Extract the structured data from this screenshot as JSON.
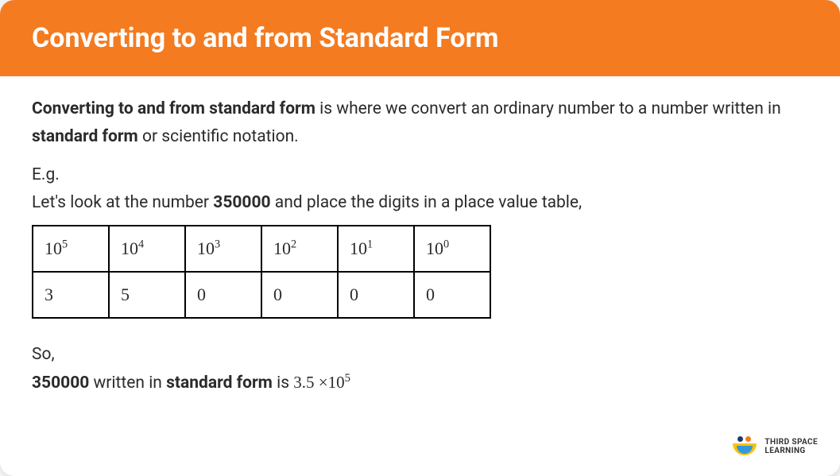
{
  "header": {
    "title": "Converting to and from Standard Form"
  },
  "intro": {
    "bold_lead": "Converting to and from standard form",
    "rest1": " is where we convert an ordinary number to a number written in ",
    "bold_mid": "standard form",
    "rest2": " or scientific notation."
  },
  "eg_label": "E.g.",
  "lets_look": {
    "pre": "Let's look at the number ",
    "number": "350000",
    "post": " and place the digits in a place value table,"
  },
  "table": {
    "headers": [
      {
        "base": "10",
        "exp": "5"
      },
      {
        "base": "10",
        "exp": "4"
      },
      {
        "base": "10",
        "exp": "3"
      },
      {
        "base": "10",
        "exp": "2"
      },
      {
        "base": "10",
        "exp": "1"
      },
      {
        "base": "10",
        "exp": "0"
      }
    ],
    "digits": [
      "3",
      "5",
      "0",
      "0",
      "0",
      "0"
    ]
  },
  "so": "So,",
  "result": {
    "number": "350000",
    "mid1": " written in ",
    "sf": "standard form",
    "mid2": " is  ",
    "coef": "3.5",
    "times": " ×",
    "base": "10",
    "exp": "5"
  },
  "brand": {
    "line1": "THIRD SPACE",
    "line2": "LEARNING"
  }
}
